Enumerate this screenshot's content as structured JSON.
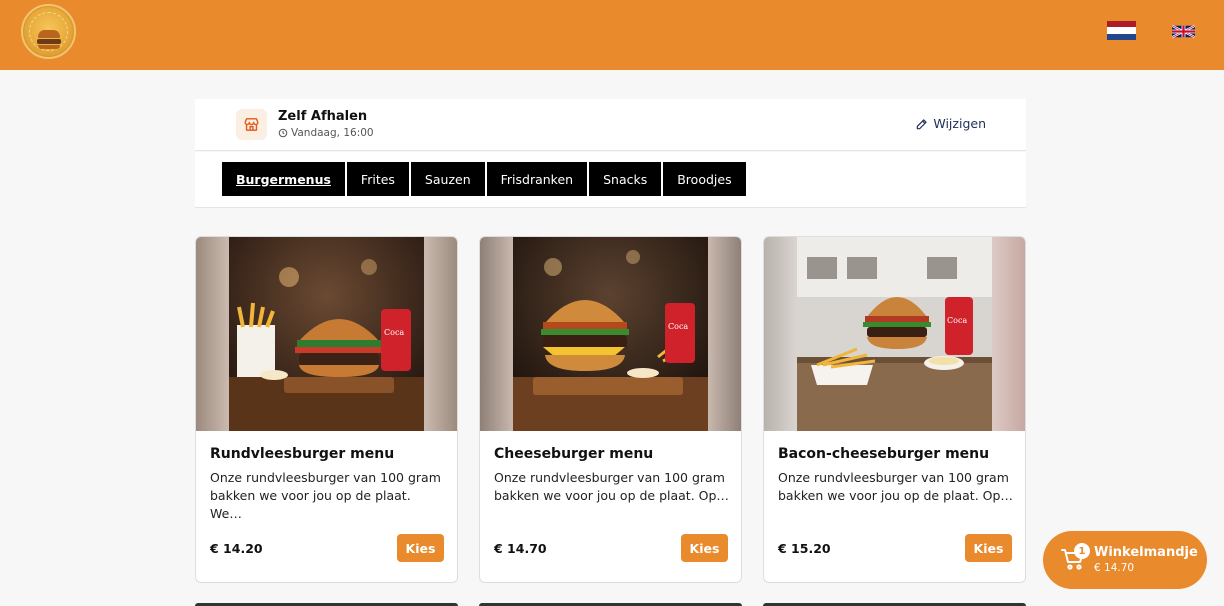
{
  "languages": [
    {
      "code": "nl",
      "icon": "dutch-flag-icon"
    },
    {
      "code": "en",
      "icon": "uk-flag-icon"
    }
  ],
  "delivery": {
    "method": "Zelf Afhalen",
    "time": "Vandaag, 16:00",
    "edit_label": "Wijzigen"
  },
  "tabs": [
    {
      "label": "Burgermenus",
      "active": true
    },
    {
      "label": "Frites",
      "active": false
    },
    {
      "label": "Sauzen",
      "active": false
    },
    {
      "label": "Frisdranken",
      "active": false
    },
    {
      "label": "Snacks",
      "active": false
    },
    {
      "label": "Broodjes",
      "active": false
    }
  ],
  "products": [
    {
      "title": "Rundvleesburger menu",
      "description": "Onze rundvleesburger van 100 gram bakken we voor jou op de plaat. We…",
      "price": "€ 14.20",
      "button": "Kies"
    },
    {
      "title": "Cheeseburger menu",
      "description": "Onze rundvleesburger van 100 gram bakken we voor jou op de plaat. Op…",
      "price": "€ 14.70",
      "button": "Kies"
    },
    {
      "title": "Bacon-cheeseburger menu",
      "description": "Onze rundvleesburger van 100 gram bakken we voor jou op de plaat. Op…",
      "price": "€ 15.20",
      "button": "Kies"
    }
  ],
  "cart": {
    "count": "1",
    "label": "Winkelmandje",
    "total": "€ 14.70"
  },
  "colors": {
    "brand": "#e98a2c",
    "tab_bg": "#000000",
    "link": "#1f2e5a"
  }
}
